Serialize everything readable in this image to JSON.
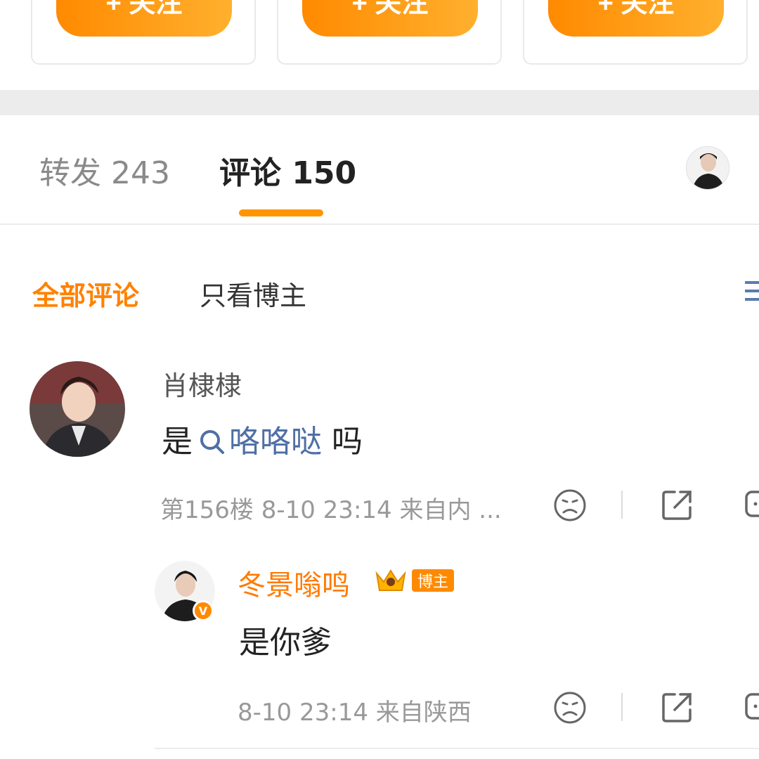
{
  "follow_cards": [
    {
      "button_label": "+ 关注"
    },
    {
      "button_label": "+ 关注"
    },
    {
      "button_label": "+ 关注"
    }
  ],
  "tabs": {
    "repost": "转发 243",
    "comment": "评论 150"
  },
  "filters": {
    "all": "全部评论",
    "blogger_only": "只看博主"
  },
  "comment": {
    "username": "肖棣棣",
    "text_before": "是",
    "topic": "咯咯哒",
    "text_after": "吗",
    "meta": "第156楼 8-10 23:14 来自内 ..."
  },
  "reply": {
    "username": "冬景嗡鸣",
    "badge": "博主",
    "text": "是你爹",
    "meta": "8-10 23:14 来自陕西"
  },
  "colors": {
    "accent": "#ff8200",
    "link": "#4f6fa5",
    "muted": "#999999"
  },
  "icons": [
    "plus-icon",
    "search-icon",
    "sort-icon",
    "sad-face-icon",
    "share-icon",
    "comment-icon",
    "verified-icon",
    "crown-icon"
  ]
}
